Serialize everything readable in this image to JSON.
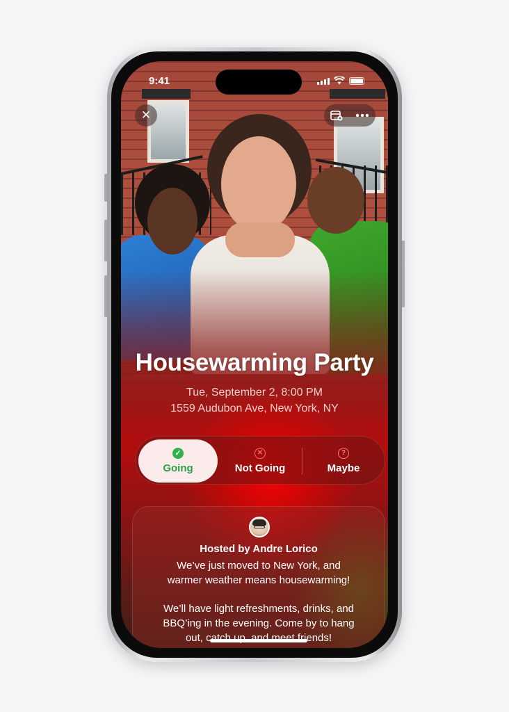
{
  "status_bar": {
    "time": "9:41"
  },
  "top_bar": {
    "close_icon": "close-icon",
    "calendar_icon": "calendar-add-icon",
    "more_icon": "more-ellipsis-icon"
  },
  "event": {
    "title": "Housewarming Party",
    "datetime": "Tue, September 2, 8:00 PM",
    "address": "1559 Audubon Ave, New York, NY"
  },
  "rsvp": {
    "options": [
      {
        "label": "Going",
        "icon": "checkmark-circle-icon",
        "selected": true
      },
      {
        "label": "Not Going",
        "icon": "x-circle-icon",
        "selected": false
      },
      {
        "label": "Maybe",
        "icon": "question-circle-icon",
        "selected": false
      }
    ]
  },
  "host": {
    "label": "Hosted by Andre Lorico",
    "message_lines_1": [
      "We’ve just moved to New York, and",
      "warmer weather means housewarming!"
    ],
    "message_lines_2": [
      "We’ll have light refreshments, drinks, and",
      "BBQ’ing in the evening. Come by to hang",
      "out, catch up, and meet friends!"
    ]
  },
  "colors": {
    "accent_going": "#2aa147",
    "not_going": "#ff6b6b",
    "background_red": "#b20d0d"
  }
}
